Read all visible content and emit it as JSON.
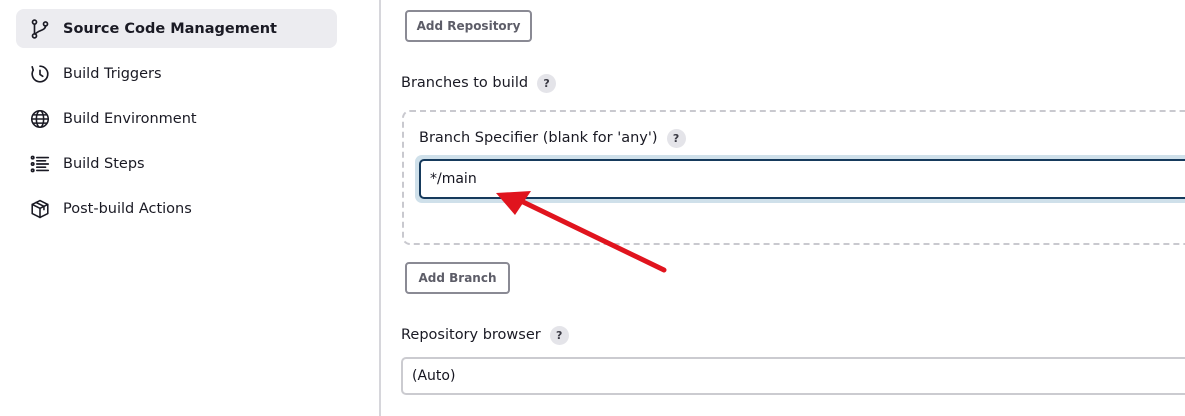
{
  "sidebar": {
    "items": [
      {
        "label": "Source Code Management",
        "icon": "git-branch-icon",
        "active": true
      },
      {
        "label": "Build Triggers",
        "icon": "clock-icon",
        "active": false
      },
      {
        "label": "Build Environment",
        "icon": "globe-icon",
        "active": false
      },
      {
        "label": "Build Steps",
        "icon": "list-icon",
        "active": false
      },
      {
        "label": "Post-build Actions",
        "icon": "package-icon",
        "active": false
      }
    ]
  },
  "main": {
    "add_repository_label": "Add Repository",
    "branches_label": "Branches to build",
    "branch_specifier_label": "Branch Specifier (blank for 'any')",
    "branch_specifier_value": "*/main",
    "add_branch_label": "Add Branch",
    "repository_browser_label": "Repository browser",
    "repository_browser_value": "(Auto)",
    "help_glyph": "?"
  },
  "colors": {
    "annotation_arrow": "#e0141e",
    "input_border": "#163a5c",
    "focus_ring": "#cfe0ea",
    "active_nav_bg": "#ececf0"
  }
}
